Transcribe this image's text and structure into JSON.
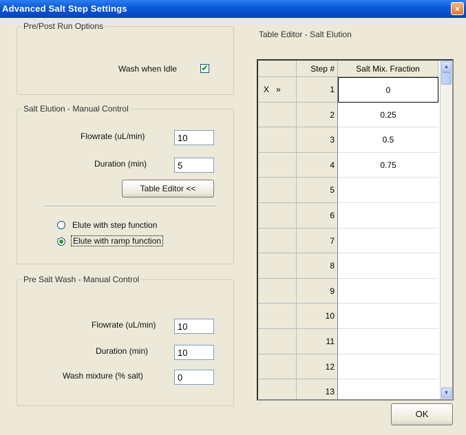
{
  "window": {
    "title": "Advanced Salt Step Settings",
    "close_glyph": "×"
  },
  "prepost": {
    "legend": "Pre/Post Run Options",
    "wash_idle_label": "Wash when Idle",
    "wash_idle_checked": true,
    "check_glyph": "✔"
  },
  "salt_elution": {
    "legend": "Salt Elution - Manual Control",
    "flowrate_label": "Flowrate (uL/min)",
    "flowrate_value": "10",
    "duration_label": "Duration (min)",
    "duration_value": "5",
    "table_editor_button": "Table Editor <<",
    "step_label": "Elute with step function",
    "ramp_label": "Elute with ramp function",
    "selected": "ramp"
  },
  "presalt": {
    "legend": "Pre Salt Wash - Manual Control",
    "flowrate_label": "Flowrate (uL/min)",
    "flowrate_value": "10",
    "duration_label": "Duration (min)",
    "duration_value": "10",
    "mixture_label": "Wash mixture (% salt)",
    "mixture_value": "0"
  },
  "table_editor": {
    "legend": "Table Editor - Salt Elution",
    "col_step": "Step #",
    "col_frac": "Salt Mix. Fraction",
    "row_marker_x": "X",
    "row_marker_arrow": "»",
    "rows": [
      {
        "step": "1",
        "frac": "0"
      },
      {
        "step": "2",
        "frac": "0.25"
      },
      {
        "step": "3",
        "frac": "0.5"
      },
      {
        "step": "4",
        "frac": "0.75"
      },
      {
        "step": "5",
        "frac": ""
      },
      {
        "step": "6",
        "frac": ""
      },
      {
        "step": "7",
        "frac": ""
      },
      {
        "step": "8",
        "frac": ""
      },
      {
        "step": "9",
        "frac": ""
      },
      {
        "step": "10",
        "frac": ""
      },
      {
        "step": "11",
        "frac": ""
      },
      {
        "step": "12",
        "frac": ""
      },
      {
        "step": "13",
        "frac": ""
      }
    ],
    "scroll_up": "▲",
    "scroll_down": "▼"
  },
  "ok_button": "OK"
}
